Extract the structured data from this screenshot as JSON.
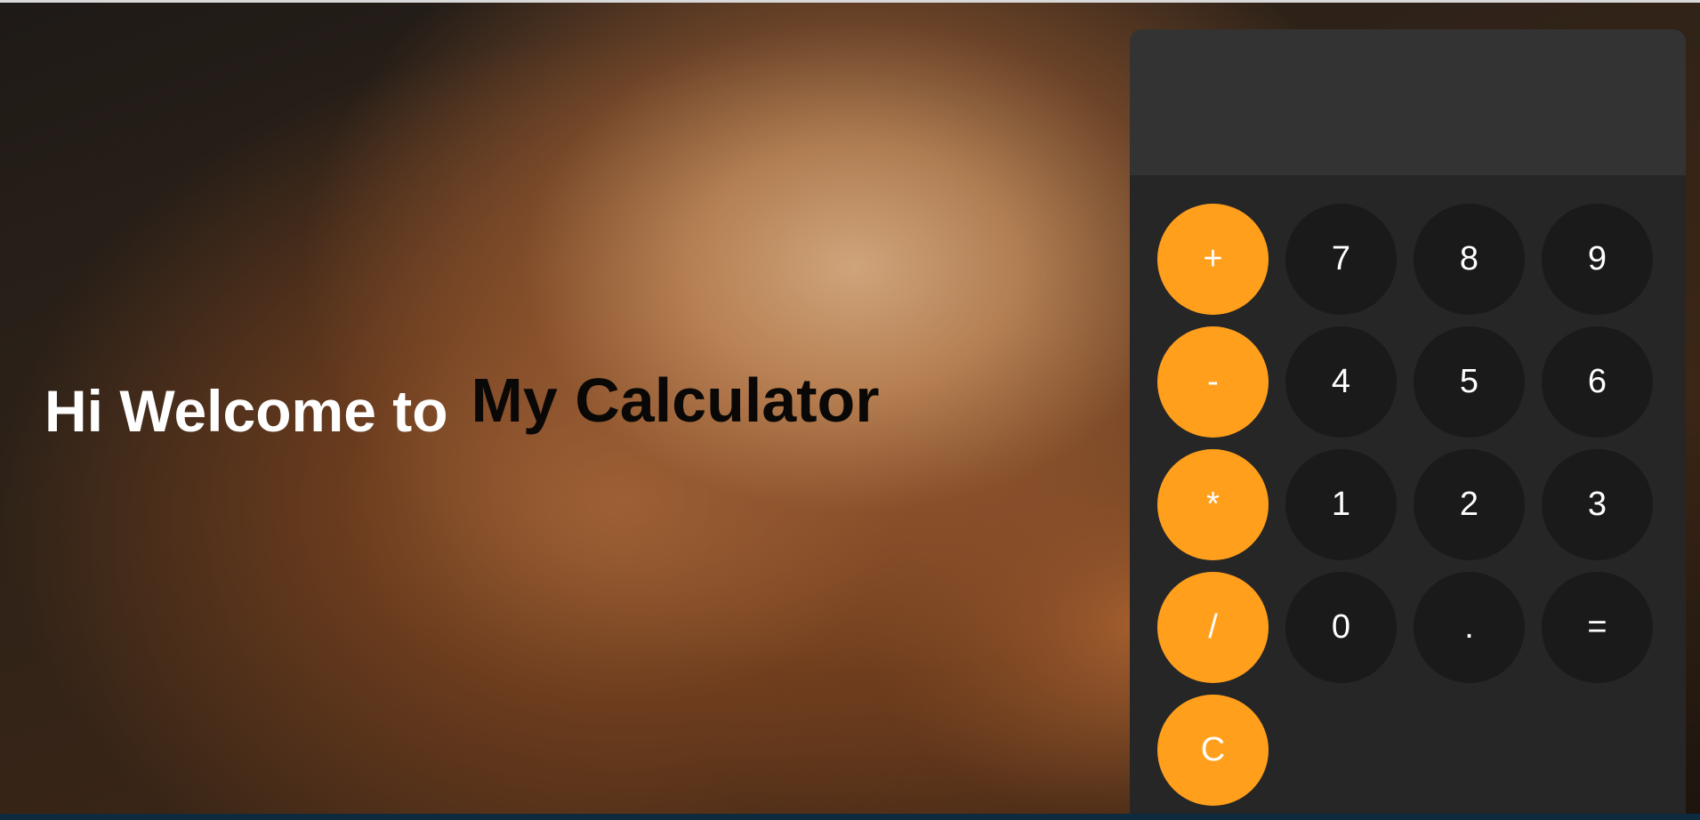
{
  "welcome": {
    "lead": "Hi Welcome to",
    "title": "My Calculator"
  },
  "calculator": {
    "display_value": "",
    "keys": {
      "plus": "+",
      "minus": "-",
      "multiply": "*",
      "divide": "/",
      "clear": "C",
      "seven": "7",
      "eight": "8",
      "nine": "9",
      "four": "4",
      "five": "5",
      "six": "6",
      "one": "1",
      "two": "2",
      "three": "3",
      "zero": "0",
      "decimal": ".",
      "equals": "="
    }
  },
  "colors": {
    "operator_key": "#ff9f1c",
    "number_key": "#1a1a1a",
    "calculator_body": "#262626",
    "display_background": "#333333"
  }
}
